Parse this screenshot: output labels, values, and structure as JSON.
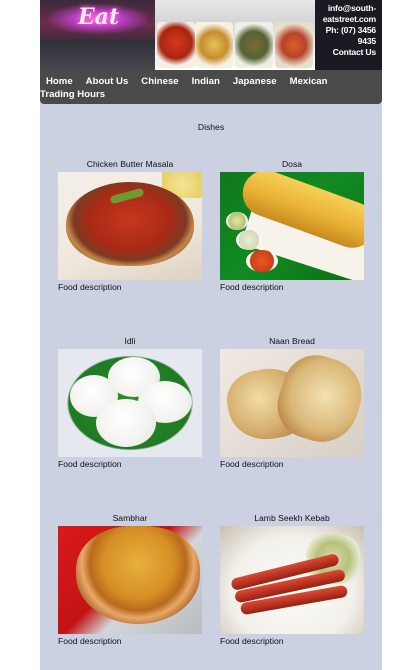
{
  "header": {
    "logo_text": "Eat",
    "contact_lines": [
      "info@south-",
      "eatstreet.com",
      "Ph: (07) 3456",
      "9435",
      "Contact Us"
    ]
  },
  "nav": {
    "items": [
      "Home",
      "About Us",
      "Chinese",
      "Indian",
      "Japanese",
      "Mexican"
    ],
    "second_row": "Trading Hours"
  },
  "main": {
    "section_title": "Dishes",
    "dishes": [
      {
        "name": "Chicken Butter Masala",
        "description": "Food description"
      },
      {
        "name": "Dosa",
        "description": "Food description"
      },
      {
        "name": "Idli",
        "description": "Food description"
      },
      {
        "name": "Naan Bread",
        "description": "Food description"
      },
      {
        "name": "Sambhar",
        "description": "Food description"
      },
      {
        "name": "Lamb Seekh Kebab",
        "description": "Food description"
      }
    ]
  }
}
